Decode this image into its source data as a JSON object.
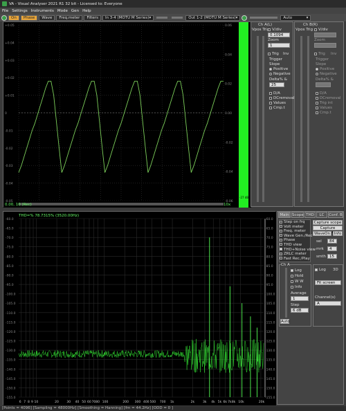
{
  "titlebar": {
    "title": "VA - Visual Analyser 2021 R1 32 bit - Licensed to: Everyone"
  },
  "menu": [
    "File",
    "Settings",
    "Instruments",
    "Mode",
    "Gen",
    "Help"
  ],
  "toolbar": {
    "on_label": "On",
    "phase_label": "Phase",
    "wave_label": "Wave",
    "freq_label": "Freq.meter",
    "filters_label": "Filters",
    "input_device": "In 3-4 (MOTU M Series)",
    "output_device": "Out 1-2 (MOTU M Series)",
    "mode_select": "Auto"
  },
  "scope": {
    "y_ticks": [
      "+0.05",
      "+0.04",
      "+0.03",
      "+0.02",
      "+0.01",
      "0",
      "-0.01",
      "-0.02",
      "-0.03",
      "-0.04",
      "-0.05"
    ],
    "right_ticks": [
      "0.06",
      "0.04",
      "0.02",
      "0.00",
      "-0.02",
      "-0.04",
      "-0.06"
    ],
    "bottom_label": "0.00, 10 (Rec)",
    "bottom_right_label": "10x",
    "meter_label": "-27 dB",
    "waveform": [
      -0.034,
      -0.03,
      -0.025,
      -0.02,
      -0.015,
      -0.01,
      -0.006,
      -0.001,
      0.004,
      0.009,
      0.014,
      0.018,
      0.018,
      0.01,
      -0.005,
      -0.02,
      -0.034,
      -0.03,
      -0.025,
      -0.02,
      -0.015,
      -0.01,
      -0.006,
      -0.001,
      0.004,
      0.009,
      0.014,
      0.018,
      0.018,
      0.01,
      -0.005,
      -0.02,
      -0.034,
      -0.03,
      -0.025,
      -0.02,
      -0.015,
      -0.01,
      -0.006,
      -0.001,
      0.004,
      0.009,
      0.014,
      0.018,
      0.018,
      0.01,
      -0.005,
      -0.02,
      -0.034,
      -0.03,
      -0.025,
      -0.02,
      -0.015,
      -0.01,
      -0.006,
      -0.001,
      0.004,
      0.009,
      0.014,
      0.018,
      0.018,
      0.01,
      -0.005,
      -0.02,
      -0.034,
      -0.03,
      -0.025,
      -0.02,
      -0.015,
      -0.01,
      -0.006,
      -0.001,
      0.004,
      0.009,
      0.014,
      0.018,
      0.018
    ]
  },
  "chA": {
    "title": "Ch A(L)",
    "vpos_label": "Vpos Trig",
    "vdiv_label": "V/div",
    "vdiv_value": "0.1094",
    "zoom_label": "Zoom",
    "zoom_value": "1",
    "trig_label": "Trig",
    "inv_label": "Inv",
    "trigger_label": "Trigger",
    "slope_label": "Slope",
    "positive_label": "Positive",
    "negative_label": "Negative",
    "delta_label": "Delta% &",
    "delta_value": "25",
    "da_label": "D/A",
    "dcremoval_label": "DCremoval",
    "values_label": "Values",
    "cmp_label": "Cmp.t"
  },
  "chB": {
    "title": "Ch B(R)",
    "vpos_label": "Vpos Trig",
    "vdiv_label": "V/div",
    "zoom_label": "Zoom",
    "trig_label": "Trig",
    "inv_label": "Inv",
    "trigger_label": "Trigger",
    "slope_label": "Slope",
    "positive_label": "Positive",
    "negative_label": "Negative",
    "delta_label": "Delta% &",
    "da_label": "D/A",
    "dcremoval_label": "DCremoval",
    "trig_int_label": "Trig int",
    "values_label": "Values",
    "cmp_label": "Cmp.t"
  },
  "spectrum": {
    "readout": "THD=% 78.7315% (3520.00Hz)",
    "y_ticks": [
      "-60.0",
      "-65.0",
      "-70.0",
      "-75.0",
      "-80.0",
      "-85.0",
      "-90.0",
      "-95.0",
      "-100.0",
      "-105.0",
      "-110.0",
      "-115.0",
      "-120.0",
      "-125.0",
      "-130.0",
      "-135.0",
      "-140.0",
      "-145.0",
      "-150.0",
      "-155.0"
    ],
    "x_ticks": [
      "6",
      "7",
      "8",
      "9",
      "10",
      "20",
      "30",
      "40",
      "50",
      "60",
      "70",
      "80",
      "100",
      "200",
      "300",
      "400",
      "500",
      "700",
      "1k",
      "2k",
      "3k",
      "4k",
      "5k",
      "6k",
      "7k",
      "8k",
      "10k",
      "20k"
    ],
    "peaks_hz": [
      3520,
      7040,
      10560,
      14080,
      17600
    ],
    "peaks_db": [
      -70,
      -96,
      -105,
      -112,
      -118
    ]
  },
  "controls": {
    "tabs": [
      "Main",
      "Scope",
      "THD",
      "LC",
      "Conf. B"
    ],
    "checklist": [
      "Step on frq",
      "Volt meter",
      "Freq. meter",
      "Wave Gen./Rec",
      "Phase",
      "THD view",
      "THD+Noise view",
      "ZRLC meter",
      "Fast Rec./Play"
    ],
    "capture_scope": "Capture scope",
    "capture_spectrum": "Capture spectrum",
    "waveon_label": "WaveOn",
    "info_label": "Info",
    "sel_label": "sel",
    "sel_value": "84",
    "mark_label": "mrk",
    "mark_value": "4",
    "smth_label": "smth",
    "smth_value": "15",
    "ch_label": "Ch A",
    "log_label": "Log",
    "hold_label": "Hold",
    "ww_label": "W W",
    "info2_label": "Info",
    "average_label": "Average",
    "average_value": "1",
    "step_label": "Step",
    "step_value": "6 dB",
    "auto_label": "Auto",
    "log2_label": "Log",
    "threed_label": "3D",
    "fit_label": "Fit screen",
    "channels_label": "Channel(s)",
    "channels_value": "A"
  },
  "status": "[Points = 4096]  [Sampling = 48000Hz]  [Smoothing = Hanning]  [fm = 44.2Hz]  [ODD = 0 ]"
}
